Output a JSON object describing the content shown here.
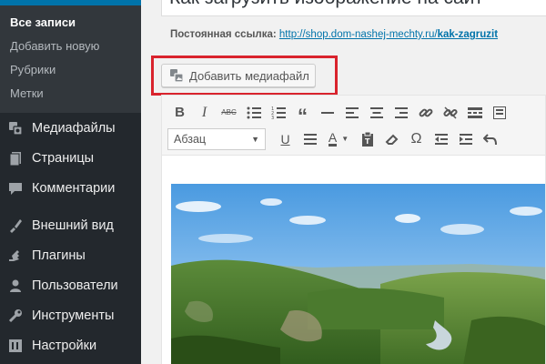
{
  "sidebar": {
    "submenu": [
      {
        "label": "Все записи",
        "current": true
      },
      {
        "label": "Добавить новую"
      },
      {
        "label": "Рубрики"
      },
      {
        "label": "Метки"
      }
    ],
    "menu": [
      {
        "label": "Медиафайлы",
        "icon": "media-icon"
      },
      {
        "label": "Страницы",
        "icon": "pages-icon"
      },
      {
        "label": "Комментарии",
        "icon": "comments-icon"
      },
      {
        "label": "Внешний вид",
        "icon": "appearance-icon"
      },
      {
        "label": "Плагины",
        "icon": "plugins-icon"
      },
      {
        "label": "Пользователи",
        "icon": "users-icon"
      },
      {
        "label": "Инструменты",
        "icon": "tools-icon"
      },
      {
        "label": "Настройки",
        "icon": "settings-icon"
      }
    ]
  },
  "post": {
    "title": "Как загрузить изображение на сайт",
    "permalink_label": "Постоянная ссылка:",
    "permalink_base": "http://shop.dom-nashej-mechty.ru/",
    "permalink_slug": "kak-zagruzit"
  },
  "editor": {
    "add_media_label": "Добавить медиафайл",
    "format_select": "Абзац"
  },
  "colors": {
    "sidebar_bg": "#23282d",
    "submenu_bg": "#32373c",
    "accent": "#0073aa",
    "highlight": "#d9232d"
  }
}
